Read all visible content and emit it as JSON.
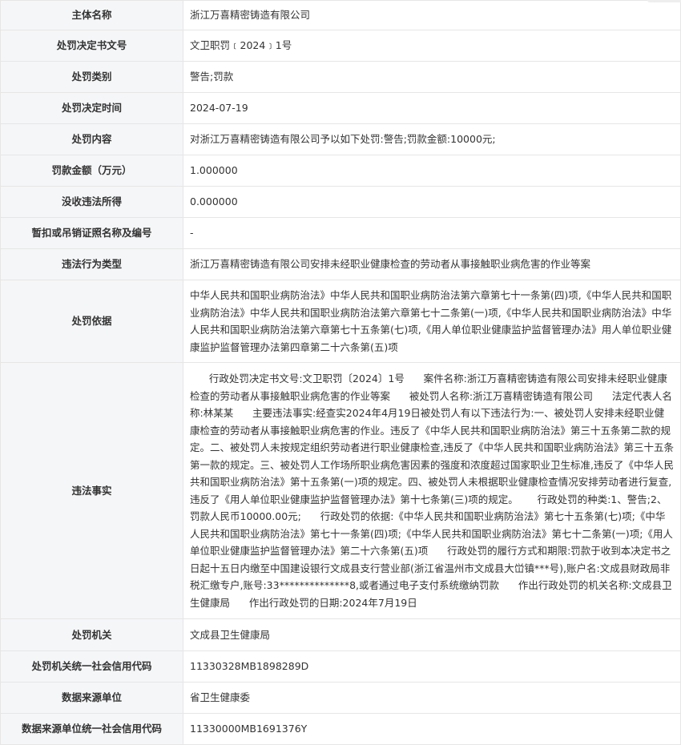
{
  "record": {
    "rows": [
      {
        "label": "主体名称",
        "value": "浙江万喜精密铸造有限公司"
      },
      {
        "label": "处罚决定书文号",
        "value": "文卫职罚﹝2024﹞1号"
      },
      {
        "label": "处罚类别",
        "value": "警告;罚款"
      },
      {
        "label": "处罚决定时间",
        "value": "2024-07-19"
      },
      {
        "label": "处罚内容",
        "value": "对浙江万喜精密铸造有限公司予以如下处罚:警告;罚款金额:10000元;"
      },
      {
        "label": "罚款金额（万元）",
        "value": "1.000000"
      },
      {
        "label": "没收违法所得",
        "value": "0.000000"
      },
      {
        "label": "暂扣或吊销证照名称及编号",
        "value": "-"
      },
      {
        "label": "违法行为类型",
        "value": "浙江万喜精密铸造有限公司安排未经职业健康检查的劳动者从事接触职业病危害的作业等案"
      },
      {
        "label": "处罚依据",
        "value": "中华人民共和国职业病防治法》中华人民共和国职业病防治法第六章第七十一条第(四)项,《中华人民共和国职业病防治法》中华人民共和国职业病防治法第六章第七十二条第(一)项,《中华人民共和国职业病防治法》中华人民共和国职业病防治法第六章第七十五条第(七)项,《用人单位职业健康监护监督管理办法》用人单位职业健康监护监督管理办法第四章第二十六条第(五)项"
      },
      {
        "label": "违法事实",
        "value": "      行政处罚决定书文号:文卫职罚〔2024〕1号      案件名称:浙江万喜精密铸造有限公司安排未经职业健康检查的劳动者从事接触职业病危害的作业等案      被处罚人名称:浙江万喜精密铸造有限公司      法定代表人名称:林某某      主要违法事实:经查实2024年4月19日被处罚人有以下违法行为:一、被处罚人安排未经职业健康检查的劳动者从事接触职业病危害的作业。违反了《中华人民共和国职业病防治法》第三十五条第二款的规定。二、被处罚人未按规定组织劳动者进行职业健康检查,违反了《中华人民共和国职业病防治法》第三十五条第一款的规定。三、被处罚人工作场所职业病危害因素的强度和浓度超过国家职业卫生标准,违反了《中华人民共和国职业病防治法》第十五条第(一)项的规定。四、被处罚人未根据职业健康检查情况安排劳动者进行复查,违反了《用人单位职业健康监护监督管理办法》第十七条第(三)项的规定。      行政处罚的种类:1、警告;2、罚款人民币10000.00元;      行政处罚的依据:《中华人民共和国职业病防治法》第七十五条第(七)项;《中华人民共和国职业病防治法》第七十一条第(四)项;《中华人民共和国职业病防治法》第七十二条第(一)项;《用人单位职业健康监护监督管理办法》第二十六条第(五)项      行政处罚的履行方式和期限:罚款于收到本决定书之日起十五日内缴至中国建设银行文成县支行营业部(浙江省温州市文成县大峃镇***号),账户名:文成县财政局非税汇缴专户,账号:33**************8,或者通过电子支付系统缴纳罚款      作出行政处罚的机关名称:文成县卫生健康局      作出行政处罚的日期:2024年7月19日"
      },
      {
        "label": "处罚机关",
        "value": "文成县卫生健康局"
      },
      {
        "label": "处罚机关统一社会信用代码",
        "value": "11330328MB1898289D"
      },
      {
        "label": "数据来源单位",
        "value": "省卫生健康委"
      },
      {
        "label": "数据来源单位统一社会信用代码",
        "value": "11330000MB1691376Y"
      }
    ]
  }
}
